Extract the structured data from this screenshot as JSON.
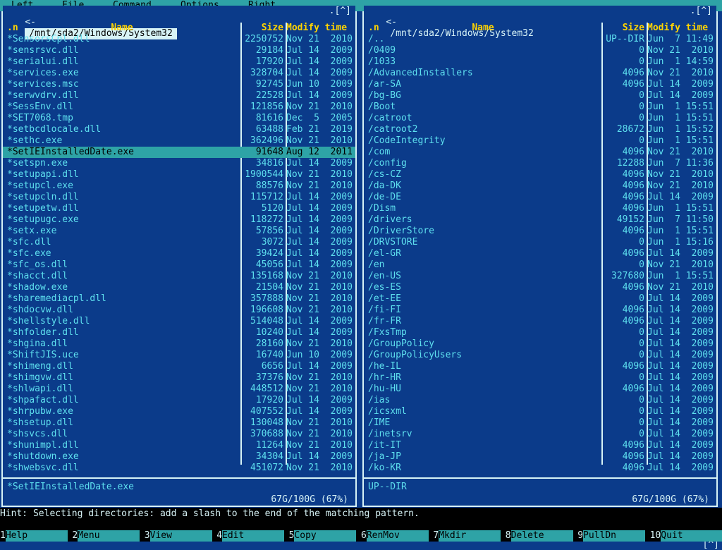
{
  "menubar": {
    "items": [
      "Left",
      "File",
      "Command",
      "Options",
      "Right"
    ]
  },
  "left_panel": {
    "path": "/mnt/sda2/Windows/System32",
    "controls": ".[^]",
    "title_prefix": "<-",
    "headers": {
      "name": "Name",
      "size": "Size",
      "time": "Modify time",
      "marker": ".n"
    },
    "rows": [
      {
        "name": "*SensorsCpl.dll",
        "size": "2250752",
        "time": "Nov 21  2010"
      },
      {
        "name": "*sensrsvc.dll",
        "size": "29184",
        "time": "Jul 14  2009"
      },
      {
        "name": "*serialui.dll",
        "size": "17920",
        "time": "Jul 14  2009"
      },
      {
        "name": "*services.exe",
        "size": "328704",
        "time": "Jul 14  2009"
      },
      {
        "name": "*services.msc",
        "size": "92745",
        "time": "Jun 10  2009"
      },
      {
        "name": "*serwvdrv.dll",
        "size": "22528",
        "time": "Jul 14  2009"
      },
      {
        "name": "*SessEnv.dll",
        "size": "121856",
        "time": "Nov 21  2010"
      },
      {
        "name": "*SET7068.tmp",
        "size": "81616",
        "time": "Dec  5  2005"
      },
      {
        "name": "*setbcdlocale.dll",
        "size": "63488",
        "time": "Feb 21  2019"
      },
      {
        "name": "*sethc.exe",
        "size": "362496",
        "time": "Nov 21  2010"
      },
      {
        "name": "*SetIEInstalledDate.exe",
        "size": "91648",
        "time": "Aug 12  2011"
      },
      {
        "name": "*setspn.exe",
        "size": "34816",
        "time": "Jul 14  2009"
      },
      {
        "name": "*setupapi.dll",
        "size": "1900544",
        "time": "Nov 21  2010"
      },
      {
        "name": "*setupcl.exe",
        "size": "88576",
        "time": "Nov 21  2010"
      },
      {
        "name": "*setupcln.dll",
        "size": "115712",
        "time": "Jul 14  2009"
      },
      {
        "name": "*setupetw.dll",
        "size": "5120",
        "time": "Jul 14  2009"
      },
      {
        "name": "*setupugc.exe",
        "size": "118272",
        "time": "Jul 14  2009"
      },
      {
        "name": "*setx.exe",
        "size": "57856",
        "time": "Jul 14  2009"
      },
      {
        "name": "*sfc.dll",
        "size": "3072",
        "time": "Jul 14  2009"
      },
      {
        "name": "*sfc.exe",
        "size": "39424",
        "time": "Jul 14  2009"
      },
      {
        "name": "*sfc_os.dll",
        "size": "45056",
        "time": "Jul 14  2009"
      },
      {
        "name": "*shacct.dll",
        "size": "135168",
        "time": "Nov 21  2010"
      },
      {
        "name": "*shadow.exe",
        "size": "21504",
        "time": "Nov 21  2010"
      },
      {
        "name": "*sharemediacpl.dll",
        "size": "357888",
        "time": "Nov 21  2010"
      },
      {
        "name": "*shdocvw.dll",
        "size": "196608",
        "time": "Nov 21  2010"
      },
      {
        "name": "*shellstyle.dll",
        "size": "514048",
        "time": "Jul 14  2009"
      },
      {
        "name": "*shfolder.dll",
        "size": "10240",
        "time": "Jul 14  2009"
      },
      {
        "name": "*shgina.dll",
        "size": "28160",
        "time": "Nov 21  2010"
      },
      {
        "name": "*ShiftJIS.uce",
        "size": "16740",
        "time": "Jun 10  2009"
      },
      {
        "name": "*shimeng.dll",
        "size": "6656",
        "time": "Jul 14  2009"
      },
      {
        "name": "*shimgvw.dll",
        "size": "37376",
        "time": "Nov 21  2010"
      },
      {
        "name": "*shlwapi.dll",
        "size": "448512",
        "time": "Nov 21  2010"
      },
      {
        "name": "*shpafact.dll",
        "size": "17920",
        "time": "Jul 14  2009"
      },
      {
        "name": "*shrpubw.exe",
        "size": "407552",
        "time": "Jul 14  2009"
      },
      {
        "name": "*shsetup.dll",
        "size": "130048",
        "time": "Nov 21  2010"
      },
      {
        "name": "*shsvcs.dll",
        "size": "370688",
        "time": "Nov 21  2010"
      },
      {
        "name": "*shunimpl.dll",
        "size": "11264",
        "time": "Nov 21  2010"
      },
      {
        "name": "*shutdown.exe",
        "size": "34304",
        "time": "Jul 14  2009"
      },
      {
        "name": "*shwebsvc.dll",
        "size": "451072",
        "time": "Nov 21  2010"
      }
    ],
    "selected_index": 10,
    "status": "*SetIEInstalledDate.exe",
    "disk": "67G/100G (67%)"
  },
  "right_panel": {
    "path": "/mnt/sda2/Windows/System32",
    "controls": ".[^]",
    "title_prefix": "<-",
    "headers": {
      "name": "Name",
      "size": "Size",
      "time": "Modify time",
      "marker": ".n"
    },
    "rows": [
      {
        "name": "/..",
        "size": "UP--DIR",
        "time": "Jun  7 11:49"
      },
      {
        "name": "/0409",
        "size": "0",
        "time": "Nov 21  2010"
      },
      {
        "name": "/1033",
        "size": "0",
        "time": "Jun  1 14:59"
      },
      {
        "name": "/AdvancedInstallers",
        "size": "4096",
        "time": "Nov 21  2010"
      },
      {
        "name": "/ar-SA",
        "size": "4096",
        "time": "Jul 14  2009"
      },
      {
        "name": "/bg-BG",
        "size": "0",
        "time": "Jul 14  2009"
      },
      {
        "name": "/Boot",
        "size": "0",
        "time": "Jun  1 15:51"
      },
      {
        "name": "/catroot",
        "size": "0",
        "time": "Jun  1 15:51"
      },
      {
        "name": "/catroot2",
        "size": "28672",
        "time": "Jun  1 15:52"
      },
      {
        "name": "/CodeIntegrity",
        "size": "0",
        "time": "Jun  1 15:51"
      },
      {
        "name": "/com",
        "size": "4096",
        "time": "Nov 21  2010"
      },
      {
        "name": "/config",
        "size": "12288",
        "time": "Jun  7 11:36"
      },
      {
        "name": "/cs-CZ",
        "size": "4096",
        "time": "Nov 21  2010"
      },
      {
        "name": "/da-DK",
        "size": "4096",
        "time": "Nov 21  2010"
      },
      {
        "name": "/de-DE",
        "size": "4096",
        "time": "Jul 14  2009"
      },
      {
        "name": "/Dism",
        "size": "4096",
        "time": "Jun  1 15:51"
      },
      {
        "name": "/drivers",
        "size": "49152",
        "time": "Jun  7 11:50"
      },
      {
        "name": "/DriverStore",
        "size": "4096",
        "time": "Jun  1 15:51"
      },
      {
        "name": "/DRVSTORE",
        "size": "0",
        "time": "Jun  1 15:16"
      },
      {
        "name": "/el-GR",
        "size": "4096",
        "time": "Jul 14  2009"
      },
      {
        "name": "/en",
        "size": "0",
        "time": "Nov 21  2010"
      },
      {
        "name": "/en-US",
        "size": "327680",
        "time": "Jun  1 15:51"
      },
      {
        "name": "/es-ES",
        "size": "4096",
        "time": "Nov 21  2010"
      },
      {
        "name": "/et-EE",
        "size": "0",
        "time": "Jul 14  2009"
      },
      {
        "name": "/fi-FI",
        "size": "4096",
        "time": "Jul 14  2009"
      },
      {
        "name": "/fr-FR",
        "size": "4096",
        "time": "Jul 14  2009"
      },
      {
        "name": "/FxsTmp",
        "size": "0",
        "time": "Jul 14  2009"
      },
      {
        "name": "/GroupPolicy",
        "size": "0",
        "time": "Jul 14  2009"
      },
      {
        "name": "/GroupPolicyUsers",
        "size": "0",
        "time": "Jul 14  2009"
      },
      {
        "name": "/he-IL",
        "size": "4096",
        "time": "Jul 14  2009"
      },
      {
        "name": "/hr-HR",
        "size": "0",
        "time": "Jul 14  2009"
      },
      {
        "name": "/hu-HU",
        "size": "4096",
        "time": "Jul 14  2009"
      },
      {
        "name": "/ias",
        "size": "0",
        "time": "Jul 14  2009"
      },
      {
        "name": "/icsxml",
        "size": "0",
        "time": "Jul 14  2009"
      },
      {
        "name": "/IME",
        "size": "0",
        "time": "Jul 14  2009"
      },
      {
        "name": "/inetsrv",
        "size": "0",
        "time": "Jul 14  2009"
      },
      {
        "name": "/it-IT",
        "size": "4096",
        "time": "Jul 14  2009"
      },
      {
        "name": "/ja-JP",
        "size": "4096",
        "time": "Jul 14  2009"
      },
      {
        "name": "/ko-KR",
        "size": "4096",
        "time": "Jul 14  2009"
      }
    ],
    "selected_index": -1,
    "status": "UP--DIR",
    "disk": "67G/100G (67%)"
  },
  "hint": "Hint: Selecting directories: add a slash to the end of the matching pattern.",
  "cmdline": {
    "prompt": "#",
    "right": "[^]"
  },
  "fnkeys": [
    {
      "num": "1",
      "label": "Help"
    },
    {
      "num": "2",
      "label": "Menu"
    },
    {
      "num": "3",
      "label": "View"
    },
    {
      "num": "4",
      "label": "Edit"
    },
    {
      "num": "5",
      "label": "Copy"
    },
    {
      "num": "6",
      "label": "RenMov"
    },
    {
      "num": "7",
      "label": "Mkdir"
    },
    {
      "num": "8",
      "label": "Delete"
    },
    {
      "num": "9",
      "label": "PullDn"
    },
    {
      "num": "10",
      "label": "Quit"
    }
  ],
  "colors": {
    "background": "#0b3b8a",
    "text": "#5ee0ef",
    "header": "#ffd400",
    "bar": "#2ea3a6"
  }
}
